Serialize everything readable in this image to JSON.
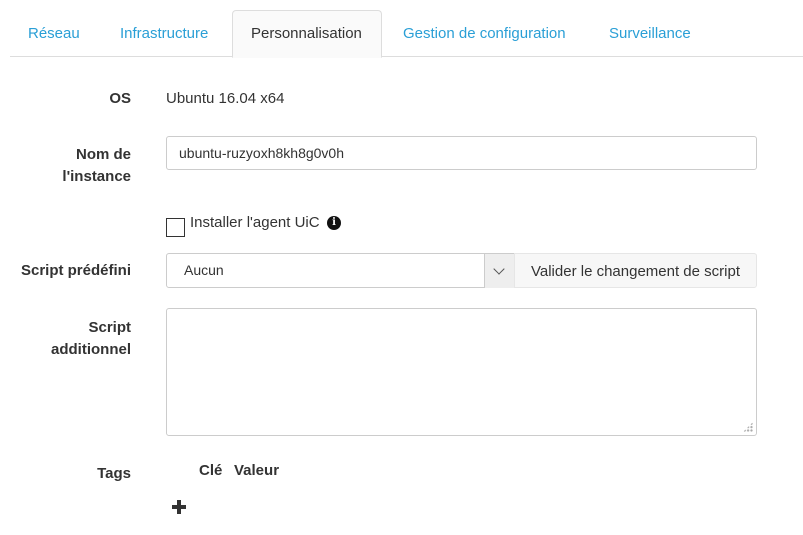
{
  "tabs": [
    {
      "label": "Réseau"
    },
    {
      "label": "Infrastructure"
    },
    {
      "label": "Personnalisation"
    },
    {
      "label": "Gestion de configuration"
    },
    {
      "label": "Surveillance"
    }
  ],
  "active_tab": "Personnalisation",
  "form": {
    "os": {
      "label": "OS",
      "value": "Ubuntu 16.04 x64"
    },
    "instance_name": {
      "label_line1": "Nom de",
      "label_line2": "l'instance",
      "value": "ubuntu-ruzyoxh8kh8g0v0h"
    },
    "agent": {
      "label": "Installer l'agent UiC",
      "checked": false,
      "info_glyph": "i"
    },
    "predefined_script": {
      "label": "Script prédéfini",
      "selected": "Aucun",
      "validate_button": "Valider le changement de script"
    },
    "additional_script": {
      "label_line1": "Script",
      "label_line2": "additionnel",
      "value": ""
    },
    "tags": {
      "label": "Tags",
      "col_key": "Clé",
      "col_value": "Valeur"
    }
  },
  "icons": {
    "info": "info-circle-icon",
    "add": "plus-icon",
    "dropdown": "chevron-down-icon"
  },
  "colors": {
    "tab_link": "#2a9fd6",
    "text": "#333333",
    "border": "#cccccc"
  }
}
